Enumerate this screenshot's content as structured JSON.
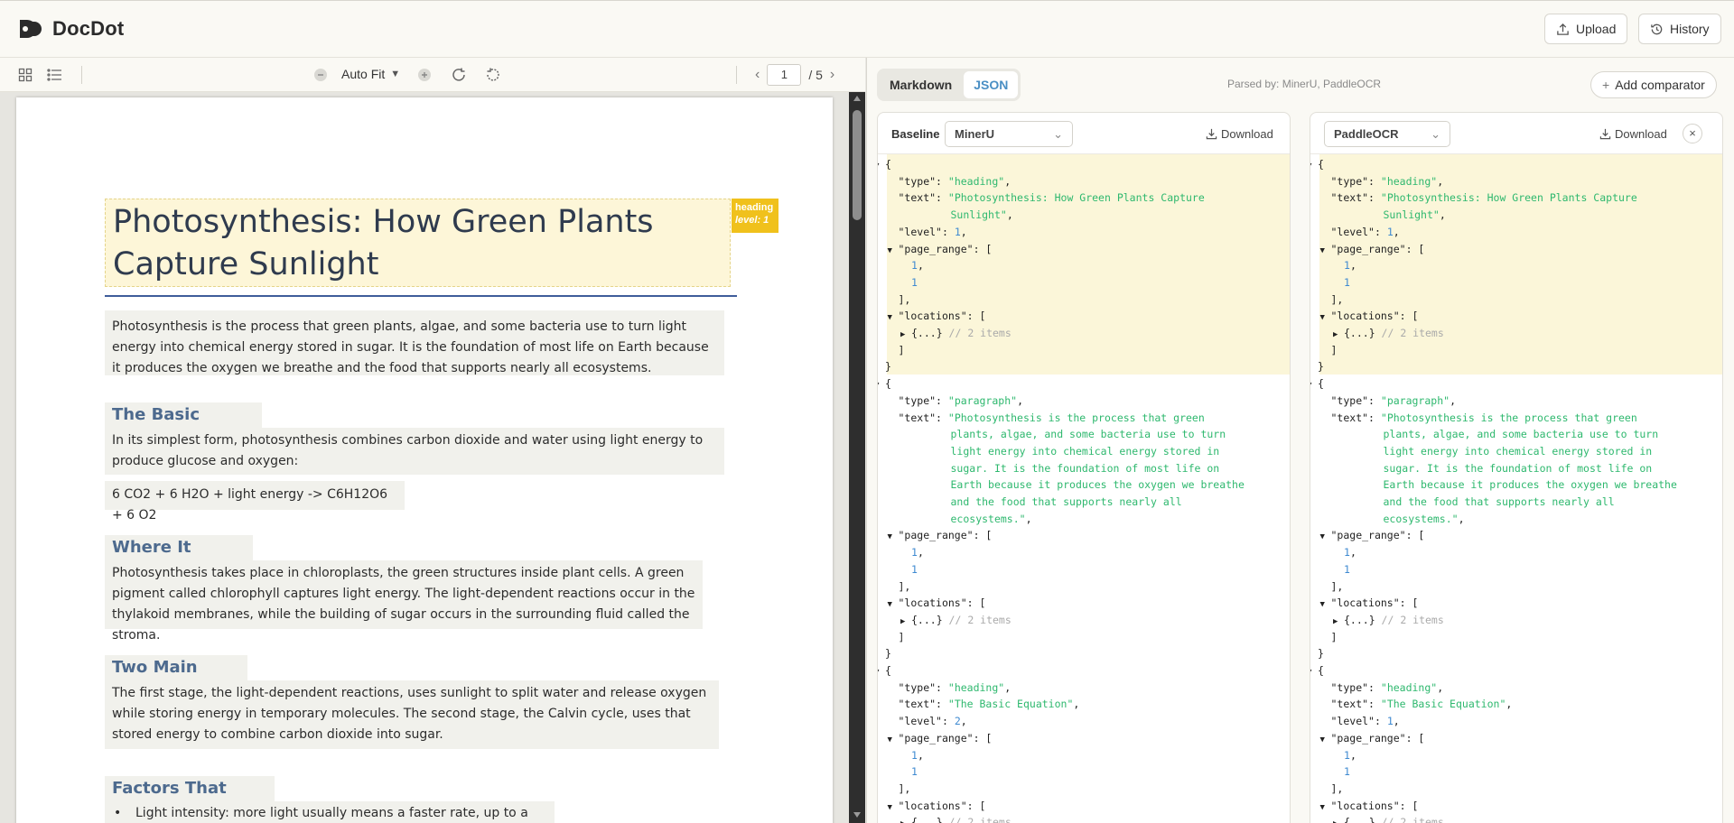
{
  "app": {
    "name": "DocDot"
  },
  "header": {
    "upload_label": "Upload",
    "history_label": "History"
  },
  "viewer": {
    "zoom_label": "Auto Fit",
    "page_current": "1",
    "page_total": "/ 5",
    "badge_type": "heading",
    "badge_level": "level: 1",
    "blocks": {
      "title": "Photosynthesis: How Green Plants Capture Sunlight",
      "intro": "Photosynthesis is the process that green plants, algae, and some bacteria use to turn light energy into chemical energy stored in sugar. It is the foundation of most life on Earth because it produces the oxygen we breathe and the food that supports nearly all ecosystems.",
      "h_equation": "The Basic Equation",
      "p_equation": "In its simplest form, photosynthesis combines carbon dioxide and water using light energy to produce glucose and oxygen:",
      "formula": "6 CO2 + 6 H2O + light energy -> C6H12O6 + 6 O2",
      "h_where": "Where It Happens",
      "p_where": "Photosynthesis takes place in chloroplasts, the green structures inside plant cells. A green pigment called chlorophyll captures light energy. The light-dependent reactions occur in the thylakoid membranes, while the building of sugar occurs in the surrounding fluid called the stroma.",
      "h_stages": "Two Main Stages",
      "p_stages": "The first stage, the light-dependent reactions, uses sunlight to split water and release oxygen while storing energy in temporary molecules. The second stage, the Calvin cycle, uses that stored energy to combine carbon dioxide into sugar.",
      "h_factors": "Factors That Affect It",
      "bullet_1": "Light intensity: more light usually means a faster rate, up to a limit."
    }
  },
  "compare": {
    "tab_markdown": "Markdown",
    "tab_json": "JSON",
    "parsed_by": "Parsed by: MinerU, PaddleOCR",
    "add_comparator": "Add comparator",
    "baseline_label": "Baseline",
    "download_label": "Download",
    "left_parser": "MinerU",
    "right_parser": "PaddleOCR",
    "left_lines": [
      [
        0,
        "▼",
        [
          [
            "p",
            "{"
          ]
        ]
      ],
      [
        1,
        "",
        [
          [
            "p",
            "\"type\": "
          ],
          [
            "s",
            "\"heading\""
          ],
          [
            "p",
            ","
          ]
        ]
      ],
      [
        1,
        "",
        [
          [
            "p",
            "\"text\": "
          ],
          [
            "s",
            "\"Photosynthesis: How Green Plants Capture"
          ]
        ]
      ],
      [
        6,
        "",
        [
          [
            "s",
            "Sunlight\""
          ],
          [
            "p",
            ","
          ]
        ]
      ],
      [
        1,
        "",
        [
          [
            "p",
            "\"level\": "
          ],
          [
            "n",
            "1"
          ],
          [
            "p",
            ","
          ]
        ]
      ],
      [
        1,
        "▼",
        [
          [
            "p",
            "\"page_range\": ["
          ]
        ]
      ],
      [
        2,
        "",
        [
          [
            "n",
            "1"
          ],
          [
            "p",
            ","
          ]
        ]
      ],
      [
        2,
        "",
        [
          [
            "n",
            "1"
          ]
        ]
      ],
      [
        1,
        "",
        [
          [
            "p",
            "],"
          ]
        ]
      ],
      [
        1,
        "▼",
        [
          [
            "p",
            "\"locations\": ["
          ]
        ]
      ],
      [
        2,
        "▶",
        [
          [
            "p",
            "{...} "
          ],
          [
            "c",
            "// 2 items"
          ]
        ]
      ],
      [
        1,
        "",
        [
          [
            "p",
            "]"
          ]
        ]
      ],
      [
        0,
        "",
        [
          [
            "p",
            "}"
          ]
        ]
      ],
      [
        0,
        "▼",
        [
          [
            "p",
            "{"
          ]
        ]
      ],
      [
        1,
        "",
        [
          [
            "p",
            "\"type\": "
          ],
          [
            "s",
            "\"paragraph\""
          ],
          [
            "p",
            ","
          ]
        ]
      ],
      [
        1,
        "",
        [
          [
            "p",
            "\"text\": "
          ],
          [
            "s",
            "\"Photosynthesis is the process that green"
          ]
        ]
      ],
      [
        6,
        "",
        [
          [
            "s",
            "plants, algae, and some bacteria use to turn"
          ]
        ]
      ],
      [
        6,
        "",
        [
          [
            "s",
            "light energy into chemical energy stored in"
          ]
        ]
      ],
      [
        6,
        "",
        [
          [
            "s",
            "sugar. It is the foundation of most life on"
          ]
        ]
      ],
      [
        6,
        "",
        [
          [
            "s",
            "Earth because it produces the oxygen we breathe"
          ]
        ]
      ],
      [
        6,
        "",
        [
          [
            "s",
            "and the food that supports nearly all"
          ]
        ]
      ],
      [
        6,
        "",
        [
          [
            "s",
            "ecosystems.\""
          ],
          [
            "p",
            ","
          ]
        ]
      ],
      [
        1,
        "▼",
        [
          [
            "p",
            "\"page_range\": ["
          ]
        ]
      ],
      [
        2,
        "",
        [
          [
            "n",
            "1"
          ],
          [
            "p",
            ","
          ]
        ]
      ],
      [
        2,
        "",
        [
          [
            "n",
            "1"
          ]
        ]
      ],
      [
        1,
        "",
        [
          [
            "p",
            "],"
          ]
        ]
      ],
      [
        1,
        "▼",
        [
          [
            "p",
            "\"locations\": ["
          ]
        ]
      ],
      [
        2,
        "▶",
        [
          [
            "p",
            "{...} "
          ],
          [
            "c",
            "// 2 items"
          ]
        ]
      ],
      [
        1,
        "",
        [
          [
            "p",
            "]"
          ]
        ]
      ],
      [
        0,
        "",
        [
          [
            "p",
            "}"
          ]
        ]
      ],
      [
        0,
        "▼",
        [
          [
            "p",
            "{"
          ]
        ]
      ],
      [
        1,
        "",
        [
          [
            "p",
            "\"type\": "
          ],
          [
            "s",
            "\"heading\""
          ],
          [
            "p",
            ","
          ]
        ]
      ],
      [
        1,
        "",
        [
          [
            "p",
            "\"text\": "
          ],
          [
            "s",
            "\"The Basic Equation\""
          ],
          [
            "p",
            ","
          ]
        ]
      ],
      [
        1,
        "",
        [
          [
            "p",
            "\"level\": "
          ],
          [
            "n",
            "2"
          ],
          [
            "p",
            ","
          ]
        ]
      ],
      [
        1,
        "▼",
        [
          [
            "p",
            "\"page_range\": ["
          ]
        ]
      ],
      [
        2,
        "",
        [
          [
            "n",
            "1"
          ],
          [
            "p",
            ","
          ]
        ]
      ],
      [
        2,
        "",
        [
          [
            "n",
            "1"
          ]
        ]
      ],
      [
        1,
        "",
        [
          [
            "p",
            "],"
          ]
        ]
      ],
      [
        1,
        "▼",
        [
          [
            "p",
            "\"locations\": ["
          ]
        ]
      ],
      [
        2,
        "▶",
        [
          [
            "p",
            "{...} "
          ],
          [
            "c",
            "// 2 items"
          ]
        ]
      ]
    ],
    "right_lines": [
      [
        0,
        "▼",
        [
          [
            "p",
            "{"
          ]
        ]
      ],
      [
        1,
        "",
        [
          [
            "p",
            "\"type\": "
          ],
          [
            "s",
            "\"heading\""
          ],
          [
            "p",
            ","
          ]
        ]
      ],
      [
        1,
        "",
        [
          [
            "p",
            "\"text\": "
          ],
          [
            "s",
            "\"Photosynthesis: How Green Plants Capture"
          ]
        ]
      ],
      [
        6,
        "",
        [
          [
            "s",
            "Sunlight\""
          ],
          [
            "p",
            ","
          ]
        ]
      ],
      [
        1,
        "",
        [
          [
            "p",
            "\"level\": "
          ],
          [
            "n",
            "1"
          ],
          [
            "p",
            ","
          ]
        ]
      ],
      [
        1,
        "▼",
        [
          [
            "p",
            "\"page_range\": ["
          ]
        ]
      ],
      [
        2,
        "",
        [
          [
            "n",
            "1"
          ],
          [
            "p",
            ","
          ]
        ]
      ],
      [
        2,
        "",
        [
          [
            "n",
            "1"
          ]
        ]
      ],
      [
        1,
        "",
        [
          [
            "p",
            "],"
          ]
        ]
      ],
      [
        1,
        "▼",
        [
          [
            "p",
            "\"locations\": ["
          ]
        ]
      ],
      [
        2,
        "▶",
        [
          [
            "p",
            "{...} "
          ],
          [
            "c",
            "// 2 items"
          ]
        ]
      ],
      [
        1,
        "",
        [
          [
            "p",
            "]"
          ]
        ]
      ],
      [
        0,
        "",
        [
          [
            "p",
            "}"
          ]
        ]
      ],
      [
        0,
        "▼",
        [
          [
            "p",
            "{"
          ]
        ]
      ],
      [
        1,
        "",
        [
          [
            "p",
            "\"type\": "
          ],
          [
            "s",
            "\"paragraph\""
          ],
          [
            "p",
            ","
          ]
        ]
      ],
      [
        1,
        "",
        [
          [
            "p",
            "\"text\": "
          ],
          [
            "s",
            "\"Photosynthesis is the process that green"
          ]
        ]
      ],
      [
        6,
        "",
        [
          [
            "s",
            "plants, algae, and some bacteria use to turn"
          ]
        ]
      ],
      [
        6,
        "",
        [
          [
            "s",
            "light energy into chemical energy stored in"
          ]
        ]
      ],
      [
        6,
        "",
        [
          [
            "s",
            "sugar. It is the foundation of most life on"
          ]
        ]
      ],
      [
        6,
        "",
        [
          [
            "s",
            "Earth because it produces the oxygen we breathe"
          ]
        ]
      ],
      [
        6,
        "",
        [
          [
            "s",
            "and the food that supports nearly all"
          ]
        ]
      ],
      [
        6,
        "",
        [
          [
            "s",
            "ecosystems.\""
          ],
          [
            "p",
            ","
          ]
        ]
      ],
      [
        1,
        "▼",
        [
          [
            "p",
            "\"page_range\": ["
          ]
        ]
      ],
      [
        2,
        "",
        [
          [
            "n",
            "1"
          ],
          [
            "p",
            ","
          ]
        ]
      ],
      [
        2,
        "",
        [
          [
            "n",
            "1"
          ]
        ]
      ],
      [
        1,
        "",
        [
          [
            "p",
            "],"
          ]
        ]
      ],
      [
        1,
        "▼",
        [
          [
            "p",
            "\"locations\": ["
          ]
        ]
      ],
      [
        2,
        "▶",
        [
          [
            "p",
            "{...} "
          ],
          [
            "c",
            "// 2 items"
          ]
        ]
      ],
      [
        1,
        "",
        [
          [
            "p",
            "]"
          ]
        ]
      ],
      [
        0,
        "",
        [
          [
            "p",
            "}"
          ]
        ]
      ],
      [
        0,
        "▼",
        [
          [
            "p",
            "{"
          ]
        ]
      ],
      [
        1,
        "",
        [
          [
            "p",
            "\"type\": "
          ],
          [
            "s",
            "\"heading\""
          ],
          [
            "p",
            ","
          ]
        ]
      ],
      [
        1,
        "",
        [
          [
            "p",
            "\"text\": "
          ],
          [
            "s",
            "\"The Basic Equation\""
          ],
          [
            "p",
            ","
          ]
        ]
      ],
      [
        1,
        "",
        [
          [
            "p",
            "\"level\": "
          ],
          [
            "n",
            "1"
          ],
          [
            "p",
            ","
          ]
        ]
      ],
      [
        1,
        "▼",
        [
          [
            "p",
            "\"page_range\": ["
          ]
        ]
      ],
      [
        2,
        "",
        [
          [
            "n",
            "1"
          ],
          [
            "p",
            ","
          ]
        ]
      ],
      [
        2,
        "",
        [
          [
            "n",
            "1"
          ]
        ]
      ],
      [
        1,
        "",
        [
          [
            "p",
            "],"
          ]
        ]
      ],
      [
        1,
        "▼",
        [
          [
            "p",
            "\"locations\": ["
          ]
        ]
      ],
      [
        2,
        "▶",
        [
          [
            "p",
            "{...} "
          ],
          [
            "c",
            "// 2 items"
          ]
        ]
      ]
    ]
  }
}
